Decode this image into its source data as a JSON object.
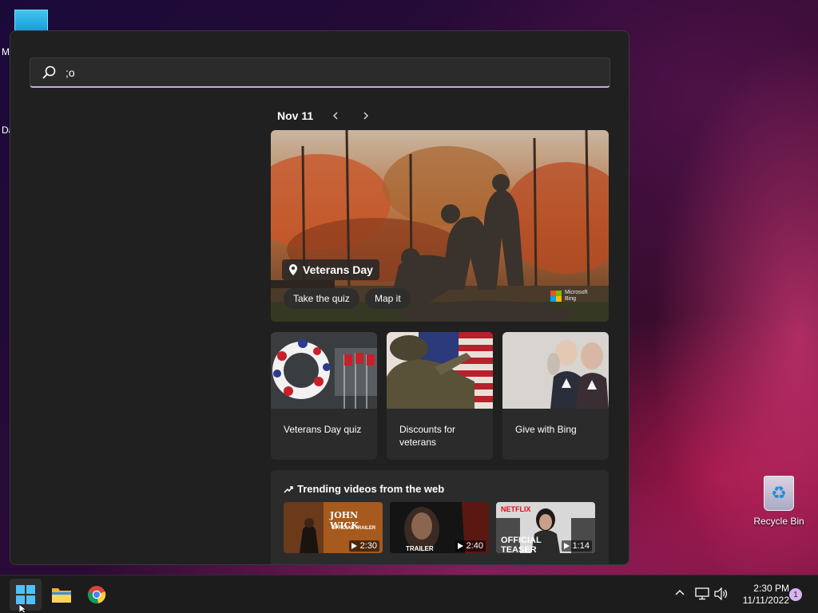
{
  "desktop": {
    "stub_labels": [
      "M",
      "Da"
    ],
    "recycle_bin_label": "Recycle Bin"
  },
  "search": {
    "value": ";o",
    "icon": "search-icon"
  },
  "calendar": {
    "date_label": "Nov 11"
  },
  "hero": {
    "place": "Veterans Day",
    "quiz_label": "Take the quiz",
    "map_label": "Map it",
    "brand_line1": "Microsoft",
    "brand_line2": "Bing"
  },
  "cards": [
    {
      "title": "Veterans Day quiz"
    },
    {
      "title": "Discounts for veterans"
    },
    {
      "title": "Give with Bing"
    }
  ],
  "trending": {
    "heading": "Trending videos from the web",
    "videos": [
      {
        "caption": "JOHN WICK",
        "sub": "OFFICIAL TRAILER",
        "duration": "2:30"
      },
      {
        "caption": "TRAILER",
        "sub": "",
        "duration": "2:40"
      },
      {
        "caption": "OFFICIAL TEASER",
        "sub": "NETFLIX",
        "duration": "1:14"
      }
    ]
  },
  "taskbar": {
    "time": "2:30 PM",
    "date": "11/11/2022",
    "notifications": "1",
    "accent": "#c8a8e8"
  }
}
